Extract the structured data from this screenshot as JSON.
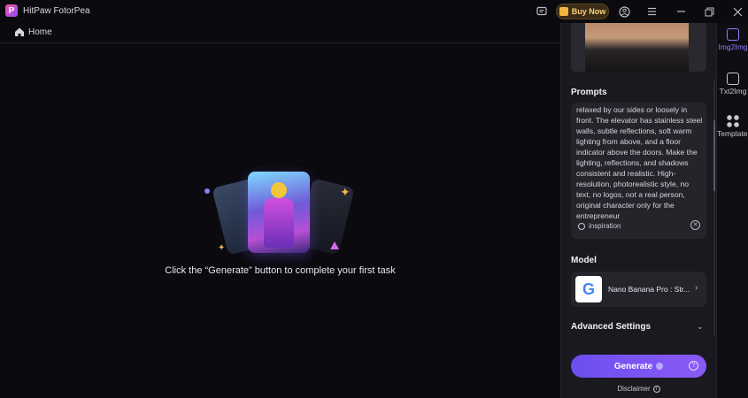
{
  "app": {
    "title": "HitPaw FotorPea",
    "logo_letter": "P"
  },
  "titlebar": {
    "buy_label": "Buy Now"
  },
  "nav": {
    "home_label": "Home"
  },
  "main": {
    "empty_message": "Click the “Generate” button to complete your first task"
  },
  "panel": {
    "prompts_title": "Prompts",
    "prompt_text": "relaxed by our sides or loosely in front. The elevator has stainless steel walls, subtle reflections, soft warm lighting from above, and a floor indicator above the doors. Make the lighting, reflections, and shadows consistent and realistic. High-resolution, photorealistic style, no text, no logos, not a real person, original character only for the entrepreneur",
    "inspiration_label": "inspiration",
    "model_title": "Model",
    "model_logo_letter": "G",
    "model_name": "Nano Banana Pro : Str...",
    "advanced_label": "Advanced Settings",
    "generate_label": "Generate",
    "disclaimer_label": "Disclaimer"
  },
  "rail": {
    "items": [
      {
        "label": "Img2Img",
        "active": true
      },
      {
        "label": "Txt2Img",
        "active": false
      },
      {
        "label": "Templates",
        "active": false
      }
    ]
  },
  "colors": {
    "accent": "#7a5af5",
    "buy": "#f2b740",
    "background": "#0b0a0e",
    "panel": "#1a191f"
  },
  "icons": [
    "app-logo-icon",
    "feedback-icon",
    "cart-icon",
    "user-icon",
    "menu-icon",
    "minimize-icon",
    "restore-icon",
    "close-icon",
    "home-icon",
    "bulb-icon",
    "clear-icon",
    "chevron-right-icon",
    "chevron-down-icon",
    "help-icon",
    "info-icon",
    "img2img-icon",
    "txt2img-icon",
    "templates-icon"
  ]
}
